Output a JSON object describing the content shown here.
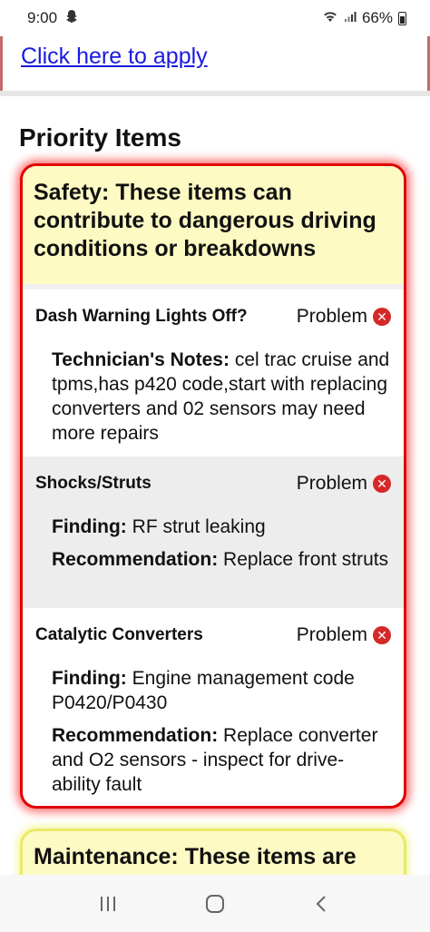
{
  "status_bar": {
    "time": "9:00",
    "battery": "66%"
  },
  "apply_link": "Click here to apply",
  "section_title": "Priority Items",
  "safety": {
    "header": "Safety: These items can contribute to dangerous driving conditions or breakdowns",
    "items": [
      {
        "name": "Dash Warning Lights Off?",
        "status": "Problem",
        "fields": [
          {
            "label": "Technician's Notes:",
            "value": " cel trac cruise and tpms,has p420 code,start with replacing converters and 02 sensors may need more repairs"
          }
        ]
      },
      {
        "name": "Shocks/Struts",
        "status": "Problem",
        "fields": [
          {
            "label": "Finding:",
            "value": " RF strut leaking"
          },
          {
            "label": "Recommendation:",
            "value": " Replace front struts"
          }
        ]
      },
      {
        "name": "Catalytic Converters",
        "status": "Problem",
        "fields": [
          {
            "label": "Finding:",
            "value": " Engine management code P0420/P0430"
          },
          {
            "label": "Recommendation:",
            "value": " Replace converter and O2 sensors - inspect for drive-ability fault"
          }
        ]
      }
    ]
  },
  "maintenance": {
    "header": "Maintenance: These items are"
  },
  "icons": {
    "status_notification": "snapchat-icon",
    "wifi": "wifi-icon",
    "signal": "signal-icon",
    "problem": "x-circle-icon",
    "nav_recent": "recent-apps-icon",
    "nav_home": "home-icon",
    "nav_back": "back-icon"
  },
  "colors": {
    "safety_border": "#e00000",
    "header_bg": "#fdfac4",
    "link": "#1a1ae0",
    "problem_icon": "#d62828"
  }
}
